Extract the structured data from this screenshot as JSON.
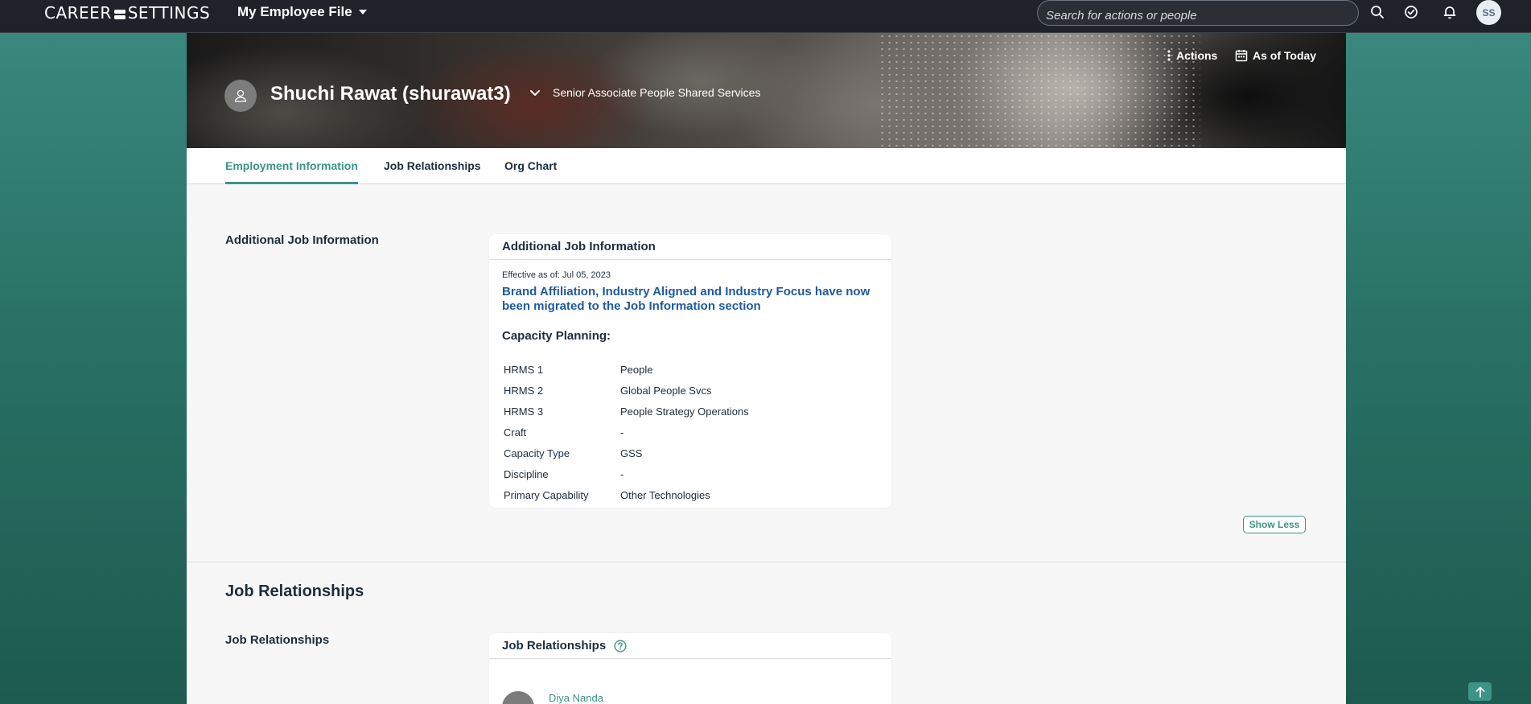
{
  "shell": {
    "brand_left": "CAREER",
    "brand_right": "SETTINGS",
    "app_menu_label": "My Employee File",
    "search_placeholder": "Search for actions or people",
    "avatar_initials": "SS"
  },
  "header": {
    "actions_label": "Actions",
    "as_of_label": "As of Today",
    "person_name": "Shuchi Rawat (shurawat3)",
    "person_title": "Senior Associate People Shared Services"
  },
  "tabs": [
    {
      "label": "Employment Information",
      "active": true
    },
    {
      "label": "Job Relationships",
      "active": false
    },
    {
      "label": "Org Chart",
      "active": false
    }
  ],
  "additional_job_info": {
    "section_label": "Additional Job Information",
    "card_title": "Additional Job Information",
    "effective": "Effective as of: Jul 05, 2023",
    "notice": "Brand Affiliation, Industry Aligned and Industry Focus have now been migrated to the Job Information section",
    "capacity_title": "Capacity Planning:",
    "rows": [
      {
        "key": "HRMS 1",
        "value": "People"
      },
      {
        "key": "HRMS 2",
        "value": "Global People Svcs"
      },
      {
        "key": "HRMS 3",
        "value": "People Strategy Operations"
      },
      {
        "key": "Craft",
        "value": "-"
      },
      {
        "key": "Capacity Type",
        "value": "GSS"
      },
      {
        "key": "Discipline",
        "value": "-"
      },
      {
        "key": "Primary Capability",
        "value": "Other Technologies"
      }
    ],
    "show_less_label": "Show Less"
  },
  "job_relationships": {
    "section_heading": "Job Relationships",
    "section_label": "Job Relationships",
    "card_title": "Job Relationships",
    "first_person": "Diya Nanda"
  },
  "colors": {
    "accent": "#3c9487",
    "link_blue": "#1f5a9e",
    "shell_bg": "#1f2329"
  }
}
